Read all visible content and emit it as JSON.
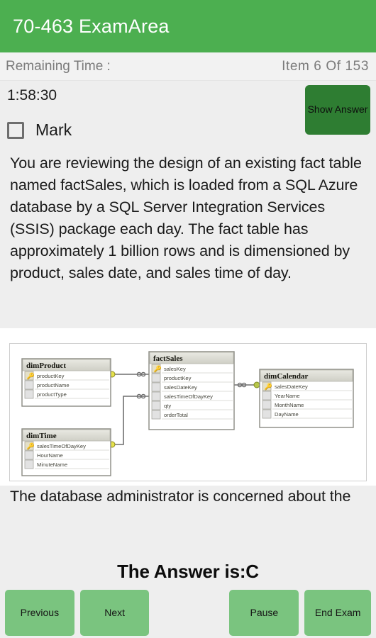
{
  "appbar": {
    "title": "70-463 ExamArea"
  },
  "status": {
    "remaining_time_label": "Remaining Time :",
    "item_counter": "Item 6 Of 153"
  },
  "meta": {
    "timer_value": "1:58:30",
    "mark_label": "Mark",
    "mark_checked": false,
    "show_answer_label": "Show Answer"
  },
  "question": {
    "text": "You are reviewing the design of an existing fact table named factSales, which is loaded from a SQL Azure database by a SQL Server Integration Services (SSIS) package each day. The fact table has approximately 1 billion rows and is dimensioned by product, sales date, and sales time of day.",
    "text_tail": "The database administrator is concerned about the"
  },
  "diagram": {
    "tables": [
      {
        "name": "dimProduct",
        "columns": [
          {
            "label": "productKey",
            "key": true
          },
          {
            "label": "productName",
            "key": false
          },
          {
            "label": "productType",
            "key": false
          }
        ]
      },
      {
        "name": "factSales",
        "columns": [
          {
            "label": "salesKey",
            "key": true
          },
          {
            "label": "productKey",
            "key": false
          },
          {
            "label": "salesDateKey",
            "key": false
          },
          {
            "label": "salesTimeOfDayKey",
            "key": false
          },
          {
            "label": "qty",
            "key": false
          },
          {
            "label": "orderTotal",
            "key": false
          }
        ]
      },
      {
        "name": "dimCalendar",
        "columns": [
          {
            "label": "salesDateKey",
            "key": true
          },
          {
            "label": "YearName",
            "key": false
          },
          {
            "label": "MonthName",
            "key": false
          },
          {
            "label": "DayName",
            "key": false
          }
        ]
      },
      {
        "name": "dimTime",
        "columns": [
          {
            "label": "salesTimeOfDayKey",
            "key": true
          },
          {
            "label": "HourName",
            "key": false
          },
          {
            "label": "MinuteName",
            "key": false
          }
        ]
      }
    ],
    "relationships": [
      {
        "from": "dimProduct.productKey",
        "to": "factSales.productKey"
      },
      {
        "from": "dimTime.salesTimeOfDayKey",
        "to": "factSales.salesTimeOfDayKey"
      },
      {
        "from": "factSales.salesDateKey",
        "to": "dimCalendar.salesDateKey"
      }
    ]
  },
  "answer": {
    "banner_text": "The Answer is:C"
  },
  "bottom": {
    "previous_label": "Previous",
    "next_label": "Next",
    "pause_label": "Pause",
    "end_exam_label": "End Exam"
  },
  "colors": {
    "appbar_green": "#4CAF50",
    "show_answer_green": "#2e7d32",
    "nav_button_green": "#7ac47f",
    "page_background": "#eeeeee",
    "muted_text": "#7b7b7b"
  }
}
